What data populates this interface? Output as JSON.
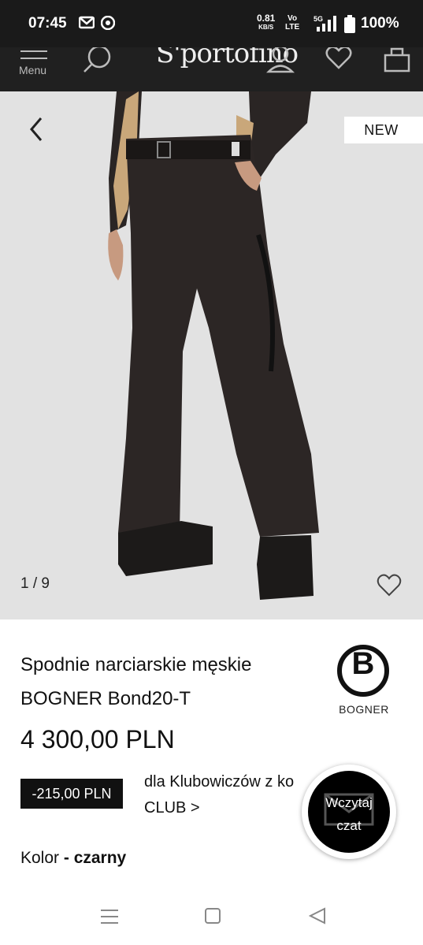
{
  "status_bar": {
    "time": "07:45",
    "speed_value": "0.81",
    "speed_unit": "KB/S",
    "volte_top": "Vo",
    "volte_bottom": "LTE",
    "network": "5G",
    "battery": "100%"
  },
  "header": {
    "menu_label": "Menu",
    "logo": "S'portofino"
  },
  "gallery": {
    "badge": "NEW",
    "counter": "1 / 9"
  },
  "product": {
    "title": "Spodnie narciarskie męskie BOGNER Bond20-T",
    "brand_letter": "B",
    "brand_name": "BOGNER",
    "price": "4 300,00 PLN",
    "discount": "-215,00 PLN",
    "club_line1": "dla Klubowiczów z ko",
    "club_line2": "CLUB >",
    "color_label": "Kolor",
    "color_value": "- czarny"
  },
  "chat": {
    "line1": "Wczytaj",
    "line2": "czat"
  },
  "colors": {
    "status_bg": "#1a1a1a",
    "header_bg": "#202020",
    "gallery_bg": "#e2e2e2",
    "accent": "#111111"
  }
}
